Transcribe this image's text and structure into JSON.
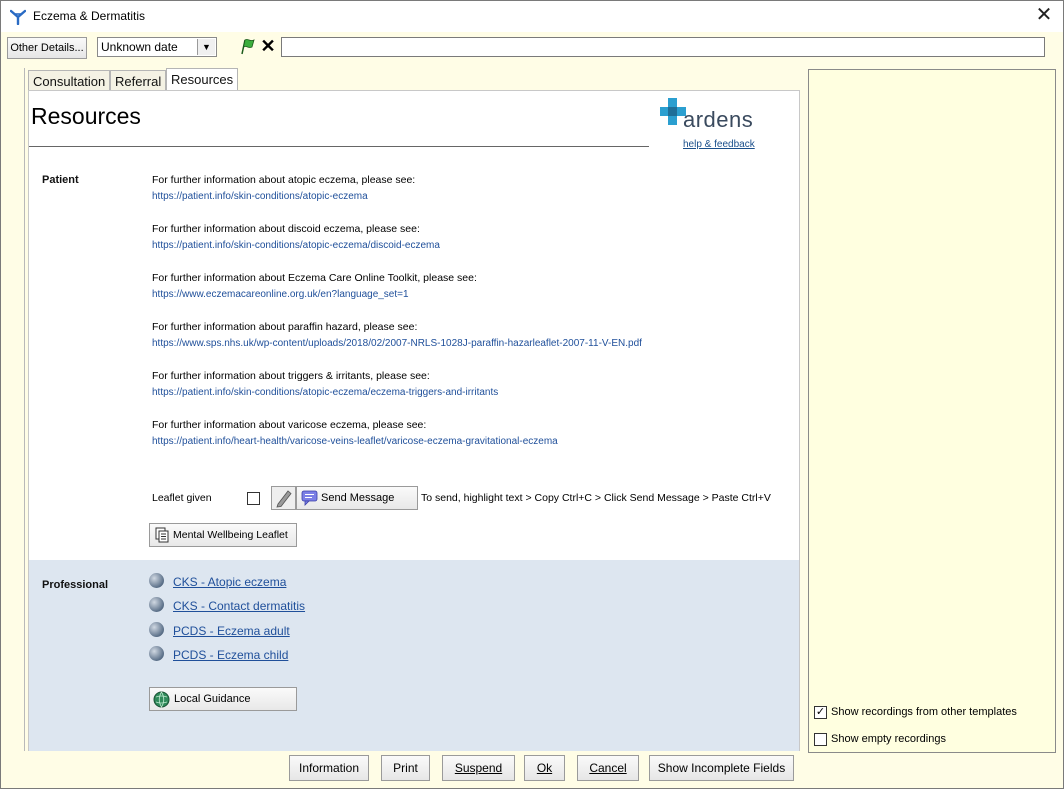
{
  "window": {
    "title": "Eczema & Dermatitis",
    "close_glyph": "✕"
  },
  "toolbar": {
    "other_details_label": "Other Details...",
    "date_value": "Unknown date",
    "date_dropdown_glyph": "▼",
    "clear_glyph": "✕",
    "note_value": ""
  },
  "tabs": [
    {
      "label": "Consultation",
      "active": false
    },
    {
      "label": "Referral",
      "active": false
    },
    {
      "label": "Resources",
      "active": true
    }
  ],
  "page": {
    "heading": "Resources",
    "logo_text": "ardens",
    "help_link": "help & feedback"
  },
  "patient": {
    "label": "Patient",
    "items": [
      {
        "text": "For further information about atopic eczema, please see:",
        "link": "https://patient.info/skin-conditions/atopic-eczema"
      },
      {
        "text": "For further information about discoid eczema, please see:",
        "link": "https://patient.info/skin-conditions/atopic-eczema/discoid-eczema"
      },
      {
        "text": "For further information about Eczema Care Online Toolkit, please see:",
        "link": "https://www.eczemacareonline.org.uk/en?language_set=1"
      },
      {
        "text": "For further information about paraffin hazard, please see:",
        "link": "https://www.sps.nhs.uk/wp-content/uploads/2018/02/2007-NRLS-1028J-paraffin-hazarleaflet-2007-11-V-EN.pdf"
      },
      {
        "text": "For further information about triggers & irritants, please see:",
        "link": "https://patient.info/skin-conditions/atopic-eczema/eczema-triggers-and-irritants"
      },
      {
        "text": "For further information about varicose eczema, please see:",
        "link": "https://patient.info/heart-health/varicose-veins-leaflet/varicose-eczema-gravitational-eczema"
      }
    ],
    "leaflet_label": "Leaflet given",
    "leaflet_checked": false,
    "send_message_label": "Send Message",
    "send_instructions": "To send, highlight text > Copy Ctrl+C > Click Send Message > Paste Ctrl+V",
    "mental_wellbeing_label": "Mental Wellbeing Leaflet"
  },
  "professional": {
    "label": "Professional",
    "links": [
      {
        "label": "CKS - Atopic eczema"
      },
      {
        "label": "CKS - Contact dermatitis"
      },
      {
        "label": "PCDS - Eczema adult"
      },
      {
        "label": "PCDS - Eczema child"
      }
    ],
    "local_guidance_label": "Local Guidance"
  },
  "bottom_buttons": {
    "information": "Information",
    "print": "Print",
    "suspend": "Suspend",
    "ok": "Ok",
    "cancel": "Cancel",
    "show_incomplete": "Show Incomplete Fields"
  },
  "right_panel": {
    "show_other_label": "Show recordings from other templates",
    "show_other_checked": true,
    "show_empty_label": "Show empty recordings",
    "show_empty_checked": false,
    "check_glyph": "✓"
  },
  "colors": {
    "link": "#1f4f9a",
    "panel_bg": "#fffde6",
    "professional_bg": "#dde6f0"
  }
}
